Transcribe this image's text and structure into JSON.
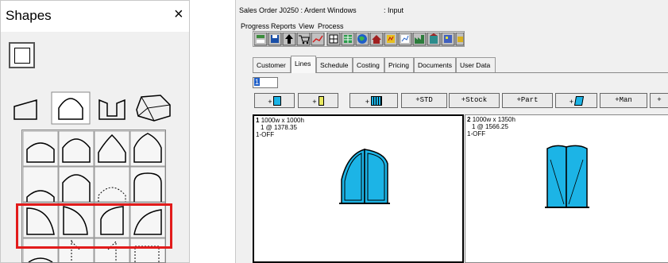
{
  "shapes": {
    "title": "Shapes",
    "close": "×"
  },
  "sales": {
    "title": "Sales Order J0250  : Ardent Windows",
    "mode": ": Input",
    "menu": [
      "Progress",
      "Reports",
      "View",
      "Process"
    ],
    "tabs": [
      "Customer",
      "Lines",
      "Schedule",
      "Costing",
      "Pricing",
      "Documents",
      "User Data"
    ],
    "active_tab": "Lines",
    "line_number_value": "1",
    "buttons": [
      "+",
      "+",
      "+",
      "+STD",
      "+Stock",
      "+Part",
      "+",
      "+Man",
      "+"
    ],
    "lines": [
      {
        "num": "1",
        "size": "1000w x 1000h",
        "qty": "1 @ 1378.35",
        "code": "1-OFF"
      },
      {
        "num": "2",
        "size": "1000w x 1350h",
        "qty": "1 @ 1566.25",
        "code": "1-OFF"
      }
    ]
  },
  "colors": {
    "glass": "#1cb4e6",
    "selection": "#e21b1b"
  }
}
